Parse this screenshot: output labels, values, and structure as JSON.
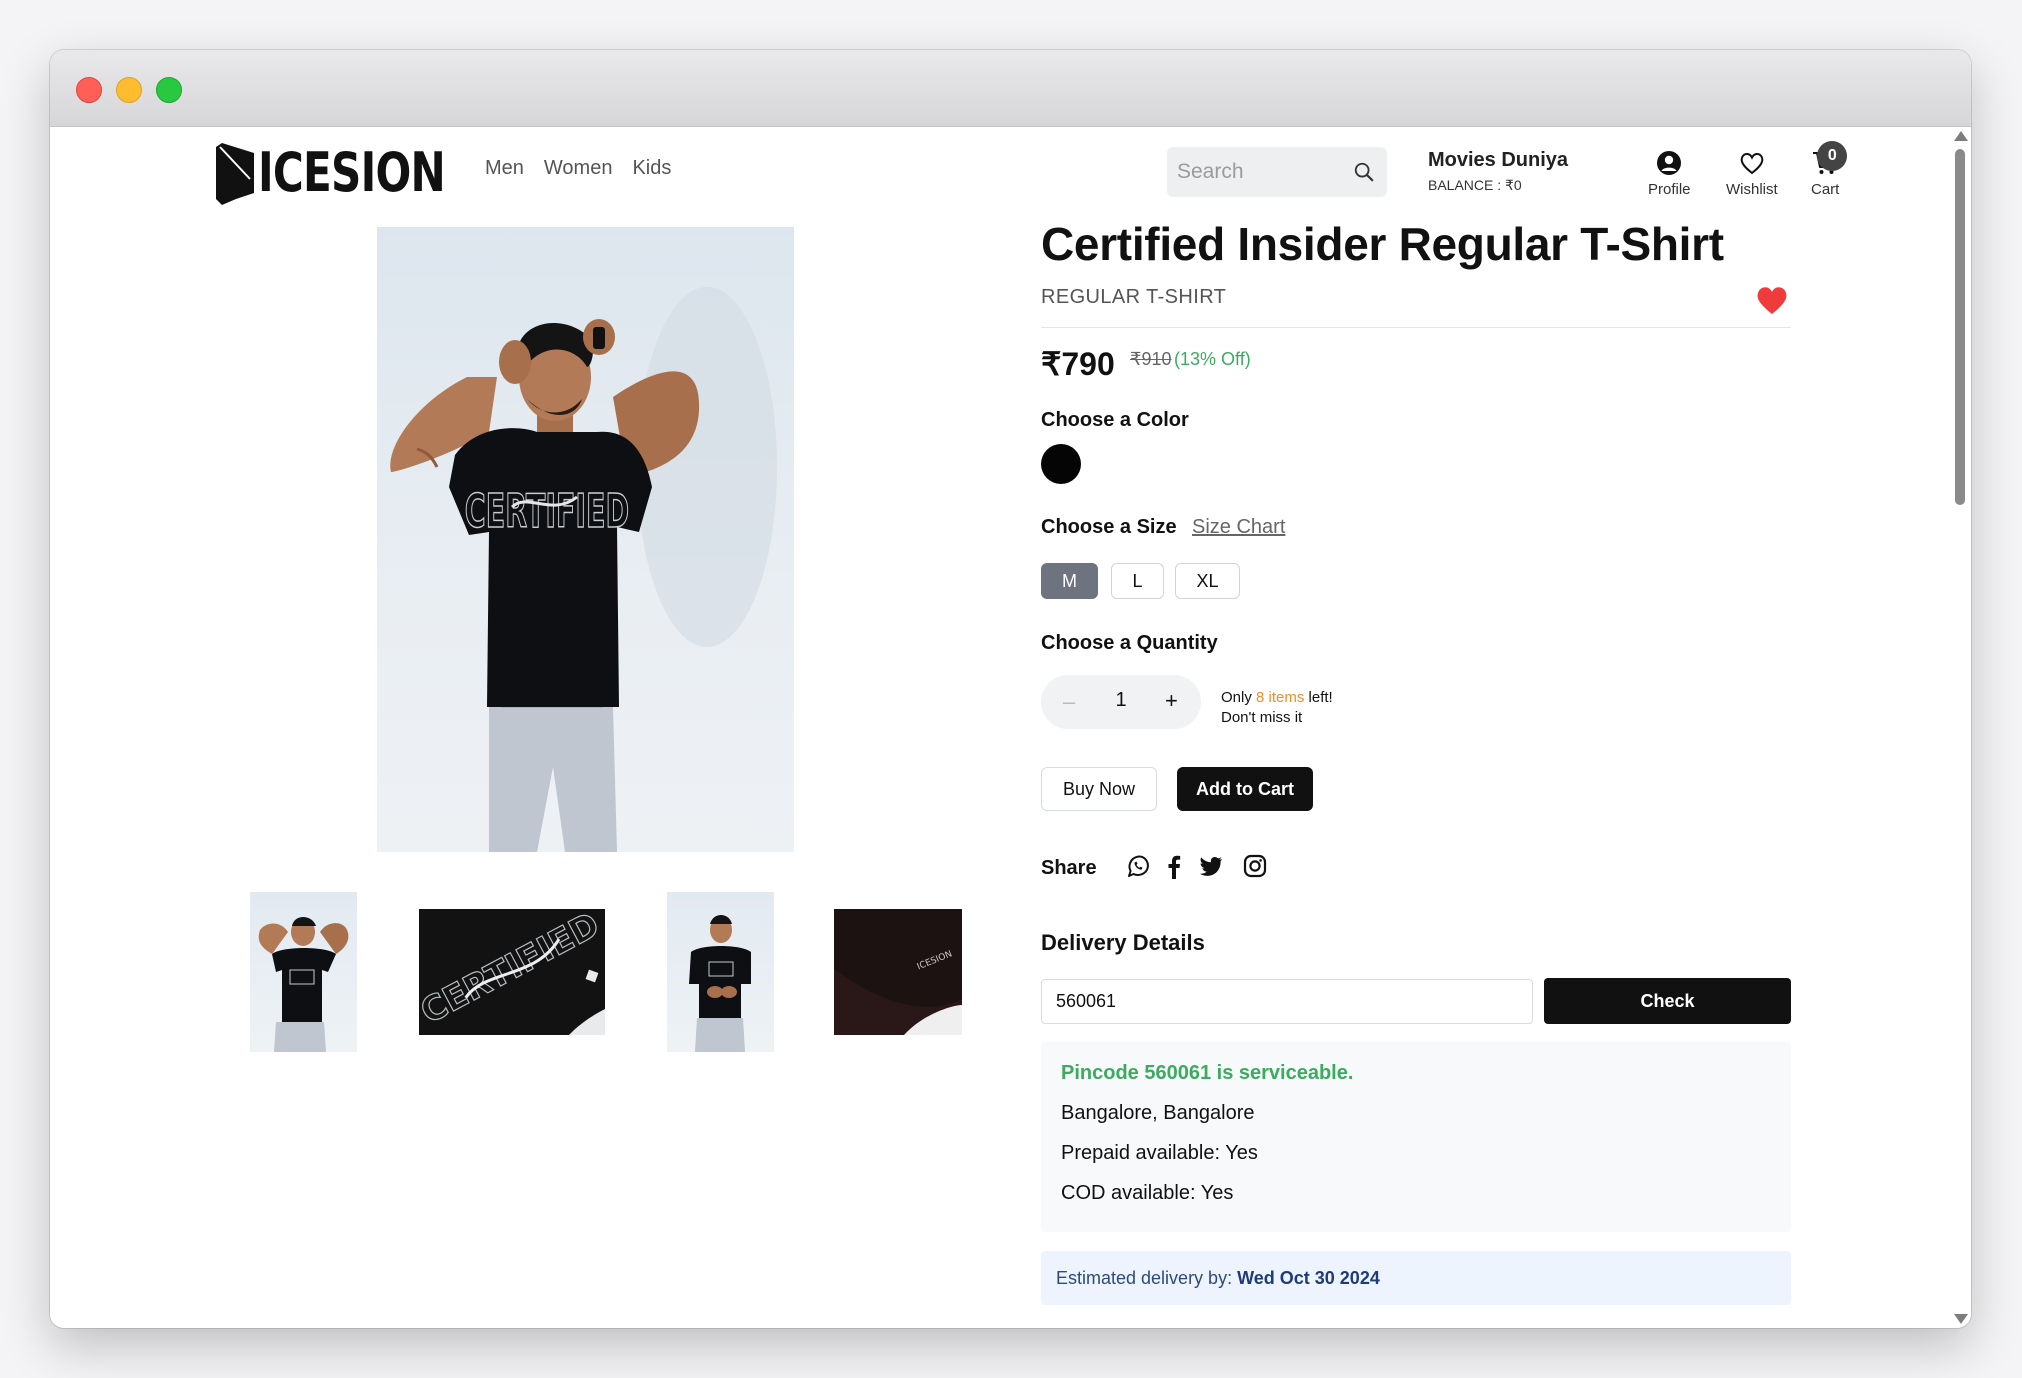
{
  "header": {
    "brand": "ICESION",
    "nav": [
      "Men",
      "Women",
      "Kids"
    ],
    "search_placeholder": "Search",
    "user_name": "Movies Duniya",
    "balance": "BALANCE : ₹0",
    "profile_label": "Profile",
    "wishlist_label": "Wishlist",
    "cart_label": "Cart",
    "cart_count": "0"
  },
  "product": {
    "title": "Certified Insider Regular T-Shirt",
    "subtitle": "REGULAR T-SHIRT",
    "price": "₹790",
    "mrp": "₹910",
    "discount": "(13% Off)",
    "color_label": "Choose a Color",
    "size_label": "Choose a Size",
    "size_chart": "Size Chart",
    "sizes": [
      "M",
      "L",
      "XL"
    ],
    "selected_size": "M",
    "quantity_label": "Choose a Quantity",
    "quantity": "1",
    "stock_only": "Only",
    "stock_items": "8 items",
    "stock_left": "left!",
    "stock_note": "Don't miss it",
    "buy_now": "Buy Now",
    "add_to_cart": "Add to Cart",
    "share_label": "Share"
  },
  "delivery": {
    "heading": "Delivery Details",
    "pincode": "560061",
    "check": "Check",
    "status": "Pincode 560061 is serviceable.",
    "city": "Bangalore, Bangalore",
    "prepaid": "Prepaid available: Yes",
    "cod": "COD available: Yes",
    "eta_label": "Estimated delivery by:",
    "eta_date": "Wed Oct 30 2024"
  },
  "colors": {
    "accent_dark": "#111111",
    "success": "#3bab5f",
    "warning": "#f08c2c",
    "heart": "#ef3b3b",
    "swatch_black": "#050505"
  },
  "icons": [
    "search-icon",
    "profile-icon",
    "wishlist-icon",
    "cart-icon",
    "heart-icon",
    "whatsapp-icon",
    "facebook-icon",
    "twitter-icon",
    "instagram-icon"
  ]
}
